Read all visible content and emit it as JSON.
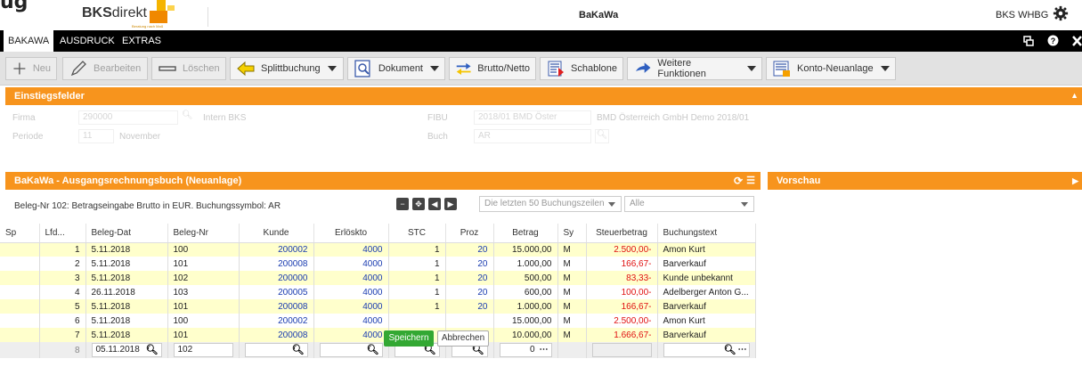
{
  "header": {
    "logo_g": "ug",
    "logo_bold": "BKS",
    "logo_light": "direkt",
    "logo_tagline": "Beratung nach Maß",
    "app_title": "BaKaWa",
    "user": "BKS WHBG"
  },
  "menu": {
    "items": [
      "BAKAWA",
      "AUSDRUCK",
      "EXTRAS"
    ]
  },
  "toolbar": {
    "new": "Neu",
    "edit": "Bearbeiten",
    "delete": "Löschen",
    "split": "Splittbuchung",
    "document": "Dokument",
    "brutto_netto": "Brutto/Netto",
    "template": "Schablone",
    "more": "Weitere Funktionen",
    "account_new": "Konto-Neuanlage"
  },
  "entry_fields": {
    "title": "Einstiegsfelder",
    "firma_label": "Firma",
    "firma_value": "290000",
    "firma_desc": "Intern BKS",
    "periode_label": "Periode",
    "periode_value": "11",
    "periode_desc": "November",
    "fibu_label": "FIBU",
    "fibu_value": "2018/01 BMD Öster",
    "fibu_desc": "BMD Österreich GmbH Demo 2018/01",
    "buch_label": "Buch",
    "buch_value": "AR"
  },
  "grid_panel": {
    "title": "BaKaWa - Ausgangsrechnungsbuch (Neuanlage)",
    "info": "Beleg-Nr 102: Betragseingabe Brutto in EUR. Buchungssymbol: AR",
    "filter_rows": "Die letzten 50 Buchungszeilen",
    "filter_all": "Alle"
  },
  "preview": {
    "title": "Vorschau"
  },
  "table": {
    "columns": [
      "Sp",
      "Lfd...",
      "Beleg-Dat",
      "Beleg-Nr",
      "Kunde",
      "Erlöskto",
      "STC",
      "Proz",
      "Betrag",
      "Sy",
      "Steuerbetrag",
      "Buchungstext"
    ],
    "rows": [
      {
        "lfd": "1",
        "date": "5.11.2018",
        "nr": "100",
        "kunde": "200002",
        "konto": "4000",
        "stc": "1",
        "proz": "20",
        "betrag": "15.000,00",
        "sy": "M",
        "steuer": "2.500,00-",
        "text": "Amon Kurt"
      },
      {
        "lfd": "2",
        "date": "5.11.2018",
        "nr": "101",
        "kunde": "200008",
        "konto": "4000",
        "stc": "1",
        "proz": "20",
        "betrag": "1.000,00",
        "sy": "M",
        "steuer": "166,67-",
        "text": "Barverkauf"
      },
      {
        "lfd": "3",
        "date": "5.11.2018",
        "nr": "102",
        "kunde": "200000",
        "konto": "4000",
        "stc": "1",
        "proz": "20",
        "betrag": "500,00",
        "sy": "M",
        "steuer": "83,33-",
        "text": "Kunde unbekannt"
      },
      {
        "lfd": "4",
        "date": "26.11.2018",
        "nr": "103",
        "kunde": "200005",
        "konto": "4000",
        "stc": "1",
        "proz": "20",
        "betrag": "600,00",
        "sy": "M",
        "steuer": "100,00-",
        "text": "Adelberger Anton G..."
      },
      {
        "lfd": "5",
        "date": "5.11.2018",
        "nr": "101",
        "kunde": "200008",
        "konto": "4000",
        "stc": "1",
        "proz": "20",
        "betrag": "1.000,00",
        "sy": "M",
        "steuer": "166,67-",
        "text": "Barverkauf"
      },
      {
        "lfd": "6",
        "date": "5.11.2018",
        "nr": "100",
        "kunde": "200002",
        "konto": "4000",
        "stc": "",
        "proz": "",
        "betrag": "15.000,00",
        "sy": "M",
        "steuer": "2.500,00-",
        "text": "Amon Kurt"
      },
      {
        "lfd": "7",
        "date": "5.11.2018",
        "nr": "101",
        "kunde": "200008",
        "konto": "4000",
        "stc": "",
        "proz": "",
        "betrag": "10.000,00",
        "sy": "M",
        "steuer": "1.666,67-",
        "text": "Barverkauf"
      }
    ],
    "input_row": {
      "lfd": "8",
      "date": "05.11.2018",
      "nr": "102",
      "betrag": "0"
    }
  },
  "actions": {
    "save": "Speichern",
    "cancel": "Abbrechen"
  }
}
